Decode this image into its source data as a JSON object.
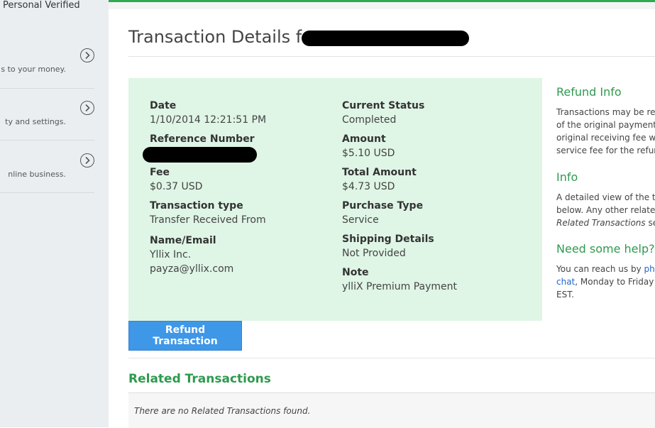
{
  "sidebar": {
    "account_status": "Personal Verified",
    "items": [
      {
        "text": "s to your money."
      },
      {
        "text": "ty and settings."
      },
      {
        "text": "nline business."
      }
    ]
  },
  "page": {
    "title": "Transaction Details for"
  },
  "details": {
    "date_label": "Date",
    "date_value": "1/10/2014 12:21:51 PM",
    "reference_label": "Reference Number",
    "fee_label": "Fee",
    "fee_value": "$0.37 USD",
    "type_label": "Transaction type",
    "type_value": "Transfer Received From",
    "name_label": "Name/Email",
    "name_value": "Yllix Inc.",
    "email_value": "payza@yllix.com",
    "status_label": "Current Status",
    "status_value": "Completed",
    "amount_label": "Amount",
    "amount_value": "$5.10 USD",
    "total_label": "Total Amount",
    "total_value": "$4.73 USD",
    "purchase_label": "Purchase Type",
    "purchase_value": "Service",
    "shipping_label": "Shipping Details",
    "shipping_value": "Not Provided",
    "note_label": "Note",
    "note_value": "ylliX Premium Payment"
  },
  "actions": {
    "refund_label": "Refund Transaction"
  },
  "related": {
    "heading": "Related Transactions",
    "empty_text": "There are no Related Transactions found."
  },
  "right_column": {
    "refund_heading": "Refund Info",
    "refund_lines": [
      "Transactions may be re",
      "of the original payment",
      "original receiving fee wi",
      "service fee for the refun"
    ],
    "info_heading": "Info",
    "info_line1": "A detailed view of the tr",
    "info_line2": "below. Any other relate",
    "info_line3_italic": "Related Transactions",
    "info_line3_rest": " sec",
    "help_heading": "Need some help?",
    "help_line1_text": "You can reach us by ",
    "help_line1_link": "pho",
    "help_line2_link": "chat",
    "help_line2_rest": ", Monday to Friday",
    "help_line3": "EST."
  },
  "colors": {
    "accent_green": "#2e9a4e",
    "panel_bg": "#dff5e6",
    "button_blue": "#3f97e8",
    "link_blue": "#2266cc"
  }
}
